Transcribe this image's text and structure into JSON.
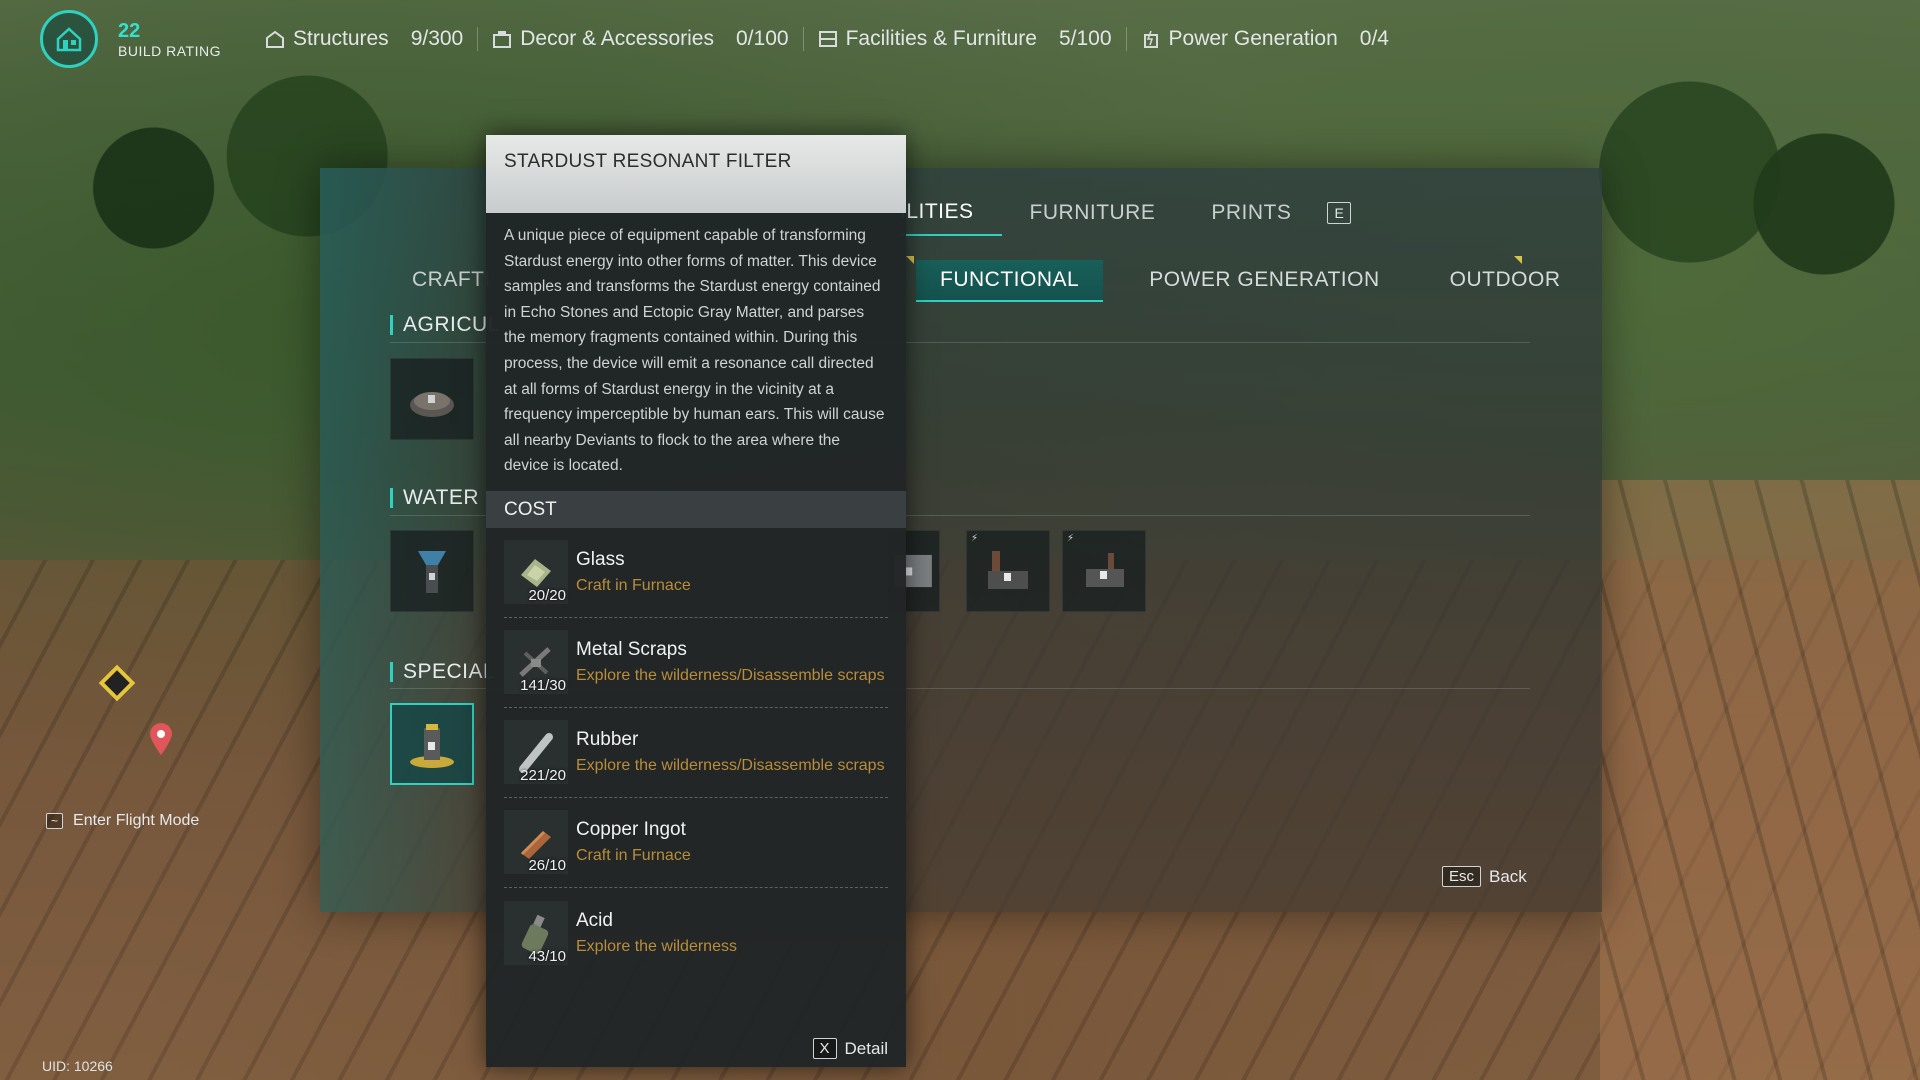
{
  "hud": {
    "build_rating_value": "22",
    "build_rating_label": "BUILD RATING",
    "stats": [
      {
        "label": "Structures",
        "value": "9/300",
        "icon": "structure-icon"
      },
      {
        "label": "Decor & Accessories",
        "value": "0/100",
        "icon": "decor-icon"
      },
      {
        "label": "Facilities & Furniture",
        "value": "5/100",
        "icon": "facilities-icon"
      },
      {
        "label": "Power Generation",
        "value": "0/4",
        "icon": "power-icon"
      }
    ]
  },
  "panel": {
    "main_tabs": [
      {
        "label": "ILITIES",
        "active": true
      },
      {
        "label": "FURNITURE",
        "active": false
      },
      {
        "label": "PRINTS",
        "active": false
      }
    ],
    "main_tab_key": "E",
    "crafting_label": "CRAFTI",
    "sub_tabs": [
      {
        "label": "FUNCTIONAL",
        "active": true
      },
      {
        "label": "POWER GENERATION",
        "active": false
      },
      {
        "label": "OUTDOOR",
        "active": false
      }
    ],
    "categories": [
      "AGRICUL",
      "WATER",
      "SPECIAL"
    ],
    "back_key": "Esc",
    "back_label": "Back"
  },
  "tooltip": {
    "title": "STARDUST RESONANT FILTER",
    "description": "A unique piece of equipment capable of transforming Stardust energy into other forms of matter. This device samples and transforms the Stardust energy contained in Echo Stones and Ectopic Gray Matter, and parses the memory fragments contained within. During this process, the device will emit a resonance call directed at all forms of Stardust energy in the vicinity at a frequency imperceptible by human ears. This will cause all nearby Deviants to flock to the area where the device is located.",
    "cost_label": "COST",
    "costs": [
      {
        "name": "Glass",
        "count": "20/20",
        "source": "Craft in Furnace",
        "icon": "glass-icon"
      },
      {
        "name": "Metal Scraps",
        "count": "141/30",
        "source": "Explore the wilderness/Disassemble scraps",
        "icon": "metal-scraps-icon"
      },
      {
        "name": "Rubber",
        "count": "221/20",
        "source": "Explore the wilderness/Disassemble scraps",
        "icon": "rubber-icon"
      },
      {
        "name": "Copper Ingot",
        "count": "26/10",
        "source": "Craft in Furnace",
        "icon": "copper-ingot-icon"
      },
      {
        "name": "Acid",
        "count": "43/10",
        "source": "Explore the wilderness",
        "icon": "acid-icon"
      }
    ],
    "detail_key": "X",
    "detail_label": "Detail"
  },
  "left_hud": {
    "flight_key": "~",
    "flight_label": "Enter Flight Mode",
    "uid": "UID: 10266"
  },
  "colors": {
    "accent": "#2fd1c0",
    "source_text": "#b98d3a",
    "waypoint": "#e6c43c"
  }
}
